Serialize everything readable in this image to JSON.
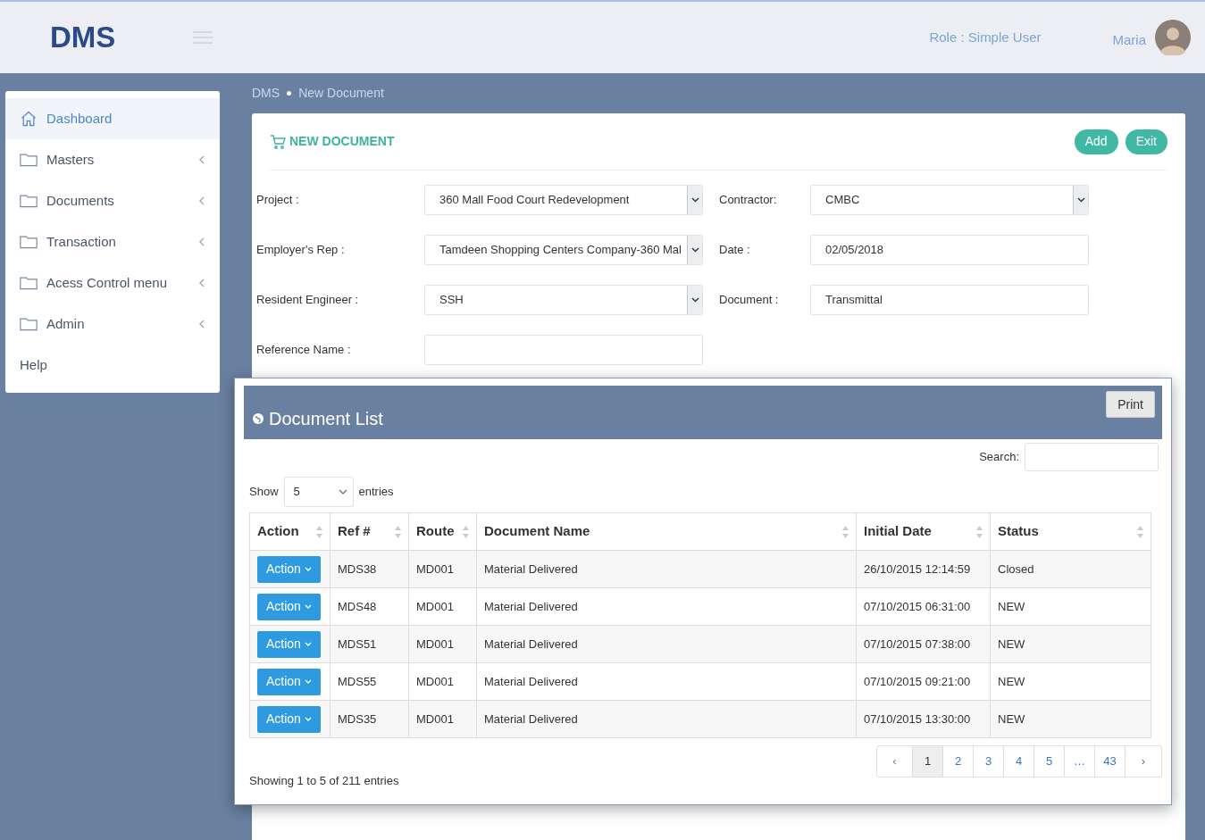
{
  "header": {
    "logo": "DMS",
    "role": "Role : Simple User",
    "user": "Maria"
  },
  "sidebar": {
    "items": [
      {
        "label": "Dashboard",
        "kind": "home",
        "selected": true
      },
      {
        "label": "Masters",
        "kind": "folder",
        "selected": false
      },
      {
        "label": "Documents",
        "kind": "folder",
        "selected": false
      },
      {
        "label": "Transaction",
        "kind": "folder",
        "selected": false
      },
      {
        "label": "Acess Control menu",
        "kind": "folder",
        "selected": false
      },
      {
        "label": "Admin",
        "kind": "folder",
        "selected": false
      },
      {
        "label": "Help",
        "kind": "plain",
        "selected": false
      }
    ]
  },
  "breadcrumb": [
    "DMS",
    "New Document"
  ],
  "form": {
    "title": "NEW DOCUMENT",
    "buttons": [
      "Add",
      "Exit"
    ],
    "fields": [
      {
        "label": "Project :",
        "value": "360 Mall Food Court Redevelopment",
        "kind": "select"
      },
      {
        "label": "Contractor:",
        "value": "CMBC",
        "kind": "select"
      },
      {
        "label": "Employer's Rep :",
        "value": "Tamdeen Shopping Centers Company-360 Mal",
        "kind": "select"
      },
      {
        "label": "Date :",
        "value": "02/05/2018",
        "kind": "text"
      },
      {
        "label": "Resident Engineer :",
        "value": "SSH",
        "kind": "select"
      },
      {
        "label": "Document :",
        "value": "Transmittal",
        "kind": "text"
      },
      {
        "label": "Reference Name :",
        "kind": "text"
      }
    ]
  },
  "document_list": {
    "title": "Document List",
    "print": "Print",
    "search_label": "Search:",
    "show_label": "Show",
    "page_length": "5",
    "entries_label": "entries",
    "columns": [
      "Action",
      "Ref #",
      "Route",
      "Document Name",
      "Initial Date",
      "Status"
    ],
    "rows": [
      {
        "action": "Action",
        "ref": "MDS38",
        "route": "MD001",
        "name": "Material Delivered",
        "date": "26/10/2015 12:14:59",
        "status": "Closed"
      },
      {
        "action": "Action",
        "ref": "MDS48",
        "route": "MD001",
        "name": "Material Delivered",
        "date": "07/10/2015 06:31:00",
        "status": "NEW"
      },
      {
        "action": "Action",
        "ref": "MDS51",
        "route": "MD001",
        "name": "Material Delivered",
        "date": "07/10/2015 07:38:00",
        "status": "NEW"
      },
      {
        "action": "Action",
        "ref": "MDS55",
        "route": "MD001",
        "name": "Material Delivered",
        "date": "07/10/2015 09:21:00",
        "status": "NEW"
      },
      {
        "action": "Action",
        "ref": "MDS35",
        "route": "MD001",
        "name": "Material Delivered",
        "date": "07/10/2015 13:30:00",
        "status": "NEW"
      }
    ],
    "pagination": {
      "prev": "‹",
      "next": "›",
      "pages": [
        {
          "label": "1",
          "selected": true
        },
        {
          "label": "2",
          "selected": false
        },
        {
          "label": "3",
          "selected": false
        },
        {
          "label": "4",
          "selected": false
        },
        {
          "label": "5",
          "selected": false
        },
        {
          "label": "…",
          "selected": false
        },
        {
          "label": "43",
          "selected": false
        }
      ]
    },
    "info": "Showing 1 to 5 of 211 entries"
  }
}
